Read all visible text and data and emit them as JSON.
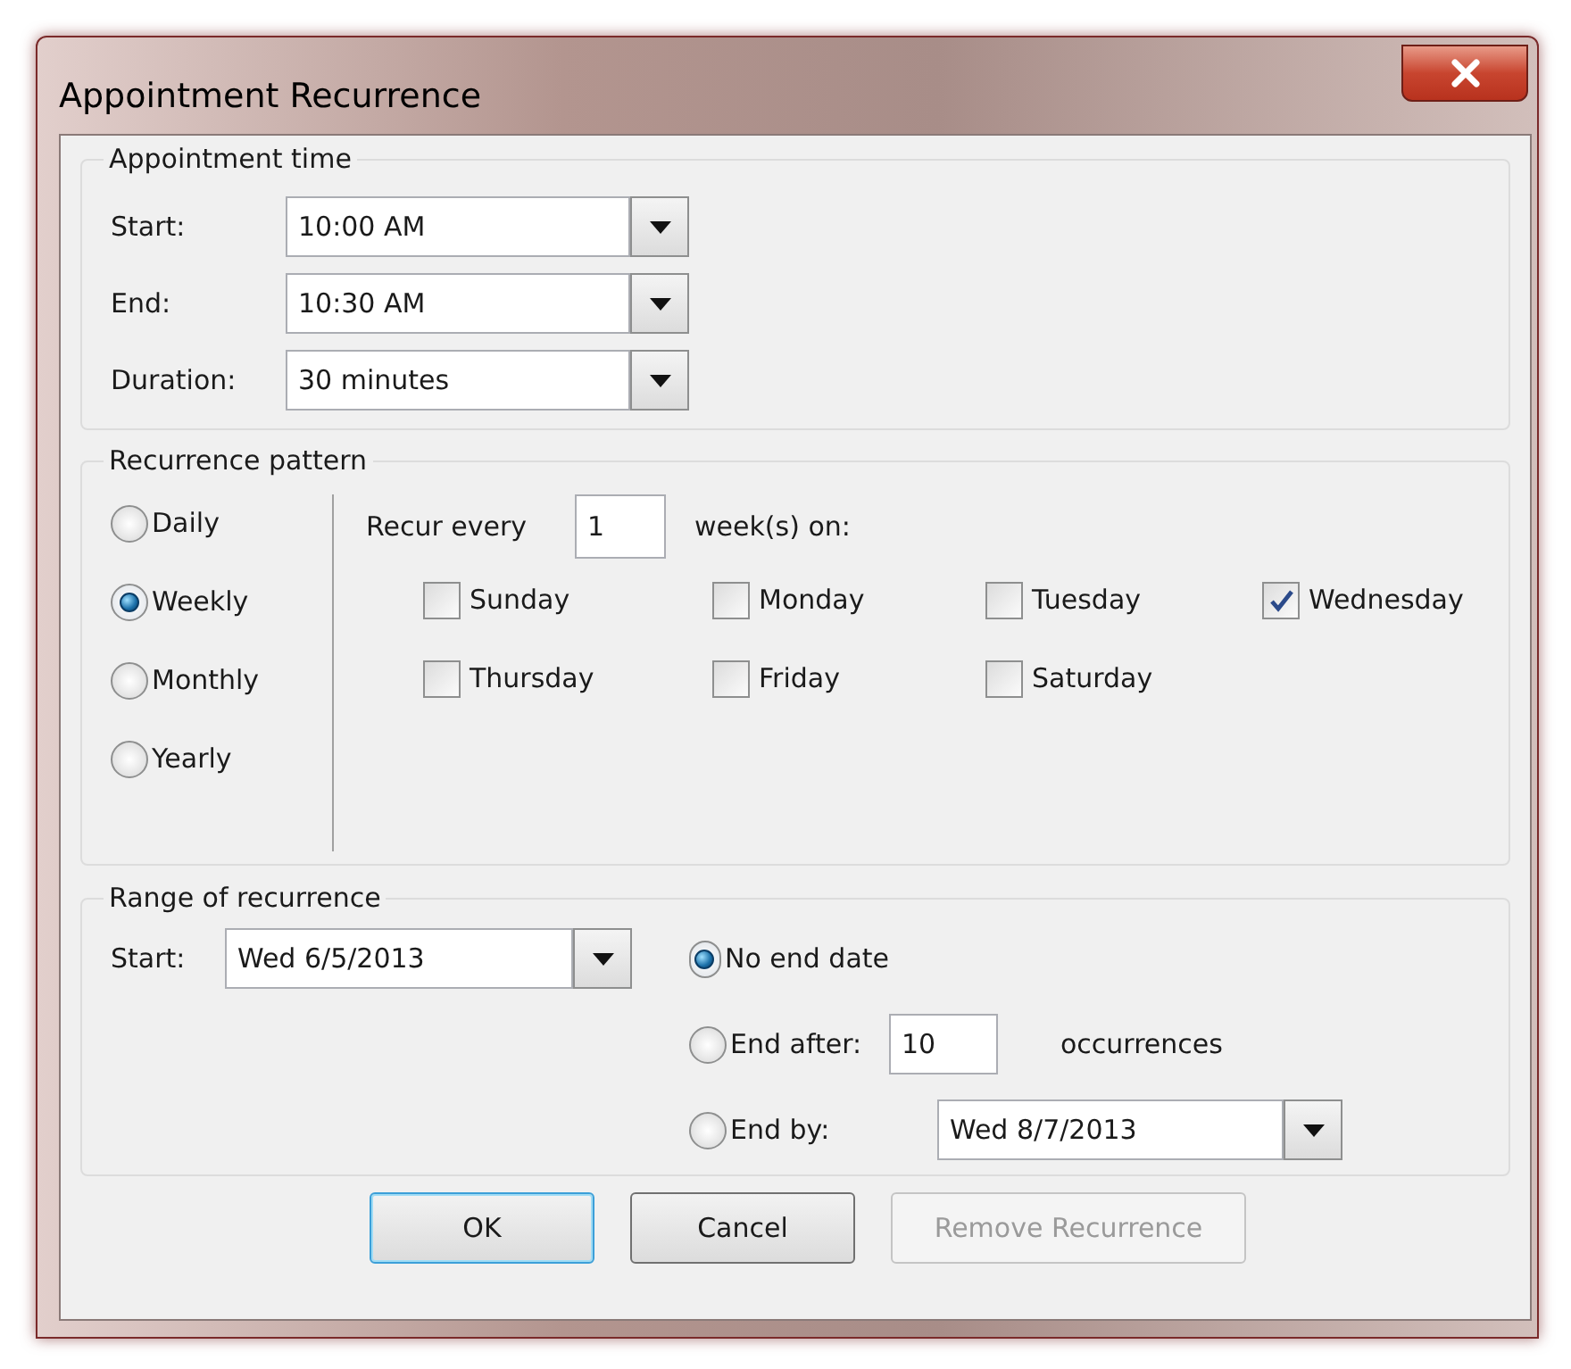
{
  "window": {
    "title": "Appointment Recurrence"
  },
  "appointment_time": {
    "legend": "Appointment time",
    "rows": [
      {
        "label": "Start:",
        "value": "10:00 AM"
      },
      {
        "label": "End:",
        "value": "10:30 AM"
      },
      {
        "label": "Duration:",
        "value": "30 minutes"
      }
    ]
  },
  "recurrence_pattern": {
    "legend": "Recurrence pattern",
    "frequencies": [
      {
        "label": "Daily",
        "selected": false
      },
      {
        "label": "Weekly",
        "selected": true
      },
      {
        "label": "Monthly",
        "selected": false
      },
      {
        "label": "Yearly",
        "selected": false
      }
    ],
    "recur_every_label": "Recur every",
    "interval": "1",
    "unit_label": "week(s) on:",
    "days": [
      {
        "label": "Sunday",
        "checked": false
      },
      {
        "label": "Monday",
        "checked": false
      },
      {
        "label": "Tuesday",
        "checked": false
      },
      {
        "label": "Wednesday",
        "checked": true
      },
      {
        "label": "Thursday",
        "checked": false
      },
      {
        "label": "Friday",
        "checked": false
      },
      {
        "label": "Saturday",
        "checked": false
      }
    ]
  },
  "range_of_recurrence": {
    "legend": "Range of recurrence",
    "start_label": "Start:",
    "start_value": "Wed 6/5/2013",
    "end_options": [
      {
        "kind": "none",
        "label": "No end date",
        "selected": true
      },
      {
        "kind": "after",
        "label": "End after:",
        "selected": false,
        "value": "10",
        "suffix": "occurrences"
      },
      {
        "kind": "by",
        "label": "End by:",
        "selected": false,
        "value": "Wed 8/7/2013"
      }
    ]
  },
  "buttons": [
    {
      "label": "OK",
      "default": true,
      "disabled": false
    },
    {
      "label": "Cancel",
      "default": false,
      "disabled": false
    },
    {
      "label": "Remove Recurrence",
      "default": false,
      "disabled": true
    }
  ]
}
